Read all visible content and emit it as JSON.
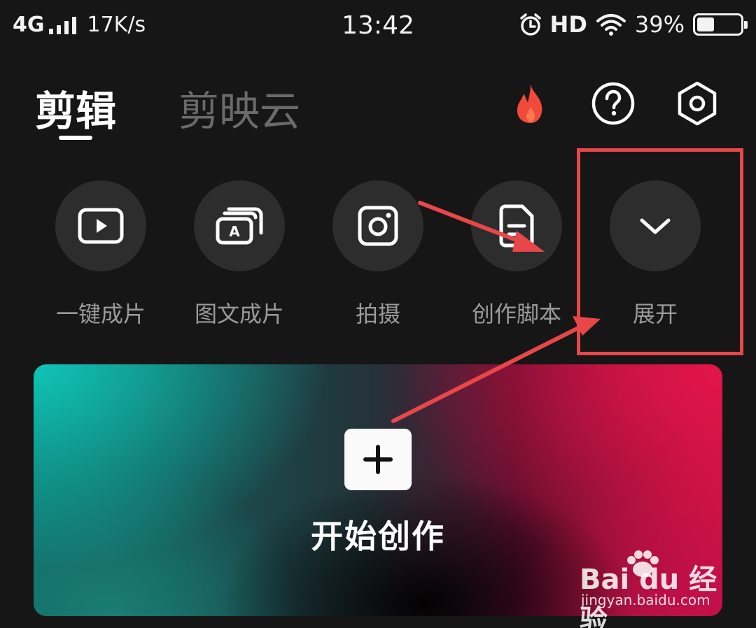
{
  "status_bar": {
    "network": "4G",
    "speed": "17K/s",
    "time": "13:42",
    "hd": "HD",
    "battery": "39%",
    "battery_level": 0.39
  },
  "tabs": [
    {
      "label": "剪辑",
      "active": true
    },
    {
      "label": "剪映云",
      "active": false
    }
  ],
  "top_icons": [
    "fire-icon",
    "help-icon",
    "settings-icon"
  ],
  "quick_actions": [
    {
      "label": "一键成片",
      "icon": "play-icon"
    },
    {
      "label": "图文成片",
      "icon": "text-image-icon"
    },
    {
      "label": "拍摄",
      "icon": "camera-icon"
    },
    {
      "label": "创作脚本",
      "icon": "script-icon"
    },
    {
      "label": "展开",
      "icon": "chevron-down-icon"
    }
  ],
  "start_card": {
    "label": "开始创作",
    "icon": "plus-icon"
  },
  "watermark": {
    "logo_text": "Bai du 经验",
    "url": "jingyan.baidu.com"
  },
  "colors": {
    "background": "#161616",
    "circle": "#2d2d2d",
    "annotation_red": "#e8474a",
    "fire": "#f1493b",
    "card_teal": "#11c4b6",
    "card_pink": "#e2154a"
  }
}
